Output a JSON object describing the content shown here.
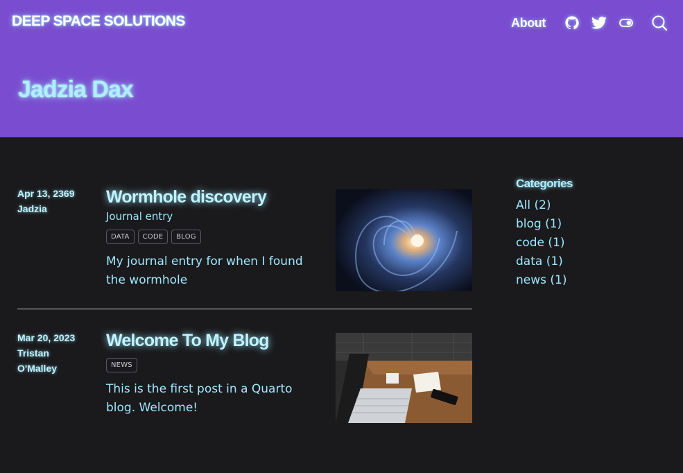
{
  "header": {
    "brand": "DEEP SPACE SOLUTIONS",
    "nav_about": "About",
    "icons": [
      "github-icon",
      "twitter-icon",
      "toggle-icon",
      "search-icon"
    ],
    "page_title": "Jadzia Dax",
    "background": "#7a4ccf"
  },
  "posts": [
    {
      "date": "Apr 13, 2369",
      "author": "Jadzia",
      "title": "Wormhole discovery",
      "subtitle": "Journal entry",
      "tags": [
        "DATA",
        "CODE",
        "BLOG"
      ],
      "description": "My journal entry for when I found the wormhole"
    },
    {
      "date": "Mar 20, 2023",
      "author_line1": "Tristan",
      "author_line2": "O'Malley",
      "title": "Welcome To My Blog",
      "tags": [
        "NEWS"
      ],
      "description": "This is the first post in a Quarto blog. Welcome!"
    }
  ],
  "sidebar": {
    "title": "Categories",
    "items": [
      {
        "label": "All (2)"
      },
      {
        "label": "blog (1)"
      },
      {
        "label": "code (1)"
      },
      {
        "label": "data (1)"
      },
      {
        "label": "news (1)"
      }
    ]
  },
  "colors": {
    "accent_text": "#9fe7ff",
    "page_background": "#1a1a1c"
  }
}
